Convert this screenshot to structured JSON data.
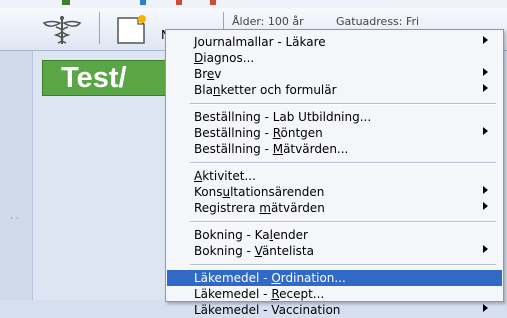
{
  "header": {
    "button_label": "N",
    "age_label": "Ålder: 100 år",
    "address_label": "Gatuadress: Fri"
  },
  "patient_banner": "Test/",
  "menu": {
    "groups": [
      [
        {
          "label": "Journalmallar - Läkare",
          "u": "",
          "submenu": true
        },
        {
          "label": "Diagnos...",
          "u": "D",
          "submenu": false
        },
        {
          "label": "Brev",
          "u": "e",
          "submenu": true
        },
        {
          "label": "Blanketter och formulär",
          "u": "n",
          "submenu": true
        }
      ],
      [
        {
          "label": "Beställning - Lab Utbildning...",
          "u": "",
          "submenu": false
        },
        {
          "label": "Beställning - Röntgen",
          "u": "R",
          "submenu": true
        },
        {
          "label": "Beställning - Mätvärden...",
          "u": "M",
          "submenu": false
        }
      ],
      [
        {
          "label": "Aktivitet...",
          "u": "A",
          "submenu": false
        },
        {
          "label": "Konsultationsärenden",
          "u": "u",
          "submenu": true
        },
        {
          "label": "Registrera mätvärden",
          "u": "m",
          "submenu": true
        }
      ],
      [
        {
          "label": "Bokning - Kalender",
          "u": "l",
          "submenu": false
        },
        {
          "label": "Bokning - Väntelista",
          "u": "V",
          "submenu": true
        }
      ],
      [
        {
          "label": "Läkemedel - Ordination...",
          "u": "O",
          "submenu": false,
          "highlighted": true
        },
        {
          "label": "Läkemedel - Recept...",
          "u": "R",
          "submenu": false
        },
        {
          "label": "Läkemedel - Vaccination",
          "u": "",
          "submenu": true
        }
      ]
    ]
  },
  "colors": {
    "menu_highlight": "#3169c6",
    "banner_green": "#5aa545"
  }
}
